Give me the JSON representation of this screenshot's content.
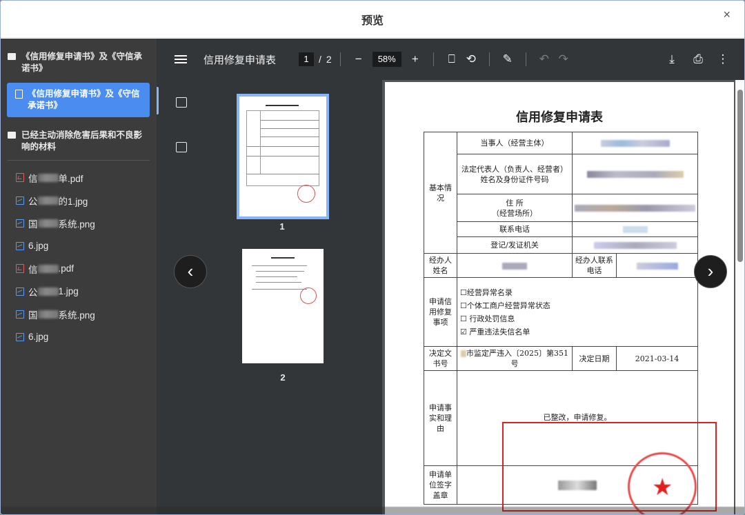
{
  "dialog": {
    "title": "预览",
    "close_label": "×"
  },
  "sidebar": {
    "group1_label": "《信用修复申请书》及《守信承诺书》",
    "active_item_label": "《信用修复申请书》及《守信承诺书》",
    "group2_label": "已经主动消除危害后果和不良影响的材料",
    "files": [
      {
        "type": "pdf",
        "prefix": "信",
        "suffix": "单.pdf"
      },
      {
        "type": "img",
        "prefix": "公",
        "suffix": "的1.jpg"
      },
      {
        "type": "img",
        "prefix": "国",
        "suffix": "系统.png"
      },
      {
        "type": "img",
        "prefix": "",
        "suffix": "6.jpg"
      },
      {
        "type": "pdf",
        "prefix": "信",
        "suffix": ".pdf"
      },
      {
        "type": "img",
        "prefix": "公",
        "suffix": "1.jpg"
      },
      {
        "type": "img",
        "prefix": "国",
        "suffix": "系统.png"
      },
      {
        "type": "img",
        "prefix": "",
        "suffix": "6.jpg"
      }
    ]
  },
  "toolbar": {
    "doc_title": "信用修复申请表",
    "current_page": "1",
    "page_sep": "/",
    "total_pages": "2",
    "zoom": "58%",
    "zoom_out": "−",
    "zoom_in": "+"
  },
  "thumbnails": [
    {
      "num": "1"
    },
    {
      "num": "2"
    }
  ],
  "document": {
    "title": "信用修复申请表",
    "section_basic": "基本情况",
    "row_party": "当事人（经营主体）",
    "row_legal": "法定代表人（负责人、经营者）姓名及身份证件号码",
    "row_address": "住 所\n（经营场所）",
    "row_phone": "联系电话",
    "row_authority": "登记/发证机关",
    "row_handler": "经办人姓名",
    "row_handler_phone": "经办人联系电话",
    "row_items": "申请信用修复事项",
    "checks": [
      "☐经营异常名录",
      "☐个体工商户经营异常状态",
      "☐ 行政处罚信息",
      "☑ 严重违法失信名单"
    ],
    "row_decision": "决定文书号",
    "decision_no": "市监定严违入〔2025〕第351号",
    "row_decision_date": "决定日期",
    "decision_date": "2021-03-14",
    "row_reason": "申请事实和理由",
    "reason_text": "已整改，申请修复。",
    "row_sign": "申请单位签字盖章"
  },
  "colors": {
    "accent": "#4a8cf0",
    "highlight": "#e02020",
    "toolbar": "#323639"
  }
}
